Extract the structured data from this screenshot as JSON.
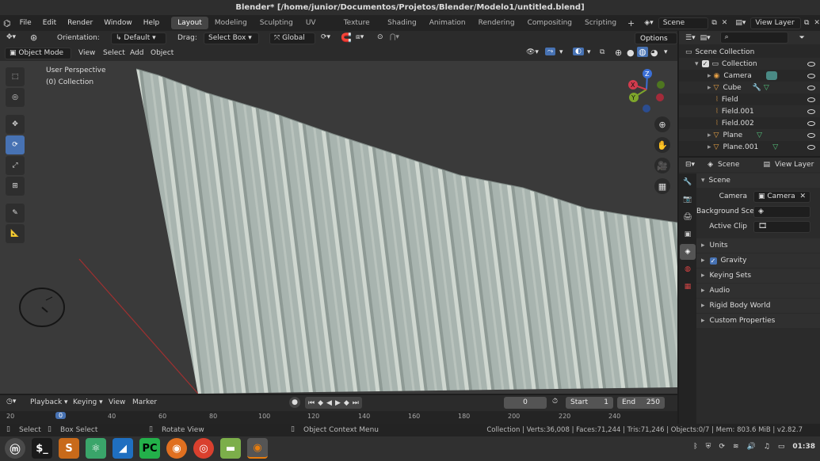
{
  "window": {
    "title": "Blender* [/home/junior/Documentos/Projetos/Blender/Modelo1/untitled.blend]"
  },
  "menu": [
    "File",
    "Edit",
    "Render",
    "Window",
    "Help"
  ],
  "workspaces": [
    "Layout",
    "Modeling",
    "Sculpting",
    "UV Editing",
    "Texture Paint",
    "Shading",
    "Animation",
    "Rendering",
    "Compositing",
    "Scripting"
  ],
  "topbar": {
    "add_workspace": "+",
    "scene": "Scene",
    "view_layer": "View Layer"
  },
  "tool_header": {
    "orientation_label": "Orientation:",
    "orientation_value": "Default",
    "drag_label": "Drag:",
    "drag_value": "Select Box",
    "transform_orientation": "Global",
    "options": "Options"
  },
  "viewport_header": {
    "mode": "Object Mode",
    "menus": [
      "View",
      "Select",
      "Add",
      "Object"
    ]
  },
  "viewport": {
    "perspective": "User Perspective",
    "collection": "(0) Collection"
  },
  "gizmo": {
    "z": "Z",
    "y": "Y",
    "x": "X"
  },
  "outliner": {
    "root": "Scene Collection",
    "collection": "Collection",
    "items": [
      {
        "name": "Camera",
        "icon": "camera-icon"
      },
      {
        "name": "Cube",
        "icon": "mesh-icon"
      },
      {
        "name": "Field",
        "icon": "forcefield-icon"
      },
      {
        "name": "Field.001",
        "icon": "forcefield-icon"
      },
      {
        "name": "Field.002",
        "icon": "forcefield-icon"
      },
      {
        "name": "Plane",
        "icon": "mesh-icon"
      },
      {
        "name": "Plane.001",
        "icon": "mesh-icon"
      }
    ]
  },
  "properties": {
    "scene_tab": "Scene",
    "view_layer_tab": "View Layer",
    "panel_title": "Scene",
    "camera_label": "Camera",
    "camera_value": "Camera",
    "background_label": "Background Sce...",
    "active_clip_label": "Active Clip",
    "sections": [
      "Units",
      "Gravity",
      "Keying Sets",
      "Audio",
      "Rigid Body World",
      "Custom Properties"
    ]
  },
  "timeline": {
    "menus": [
      "Playback",
      "Keying",
      "View",
      "Marker"
    ],
    "current_frame": "0",
    "start_label": "Start",
    "start": "1",
    "end_label": "End",
    "end": "250",
    "ruler": [
      "20",
      "40",
      "60",
      "80",
      "100",
      "120",
      "140",
      "160",
      "180",
      "200",
      "220",
      "240"
    ],
    "playhead": "0"
  },
  "statusbar": {
    "select": "Select",
    "box_select": "Box Select",
    "rotate_view": "Rotate View",
    "context_menu": "Object Context Menu",
    "stats": "Collection | Verts:36,008 | Faces:71,244 | Tris:71,246 | Objects:0/7 | Mem: 803.6 MiB | v2.82.7"
  },
  "taskbar": {
    "clock": "01:38"
  },
  "colors": {
    "accent": "#4772b3",
    "active_orange": "#e87d0d",
    "mesh_gray": "#a7b2ad"
  }
}
